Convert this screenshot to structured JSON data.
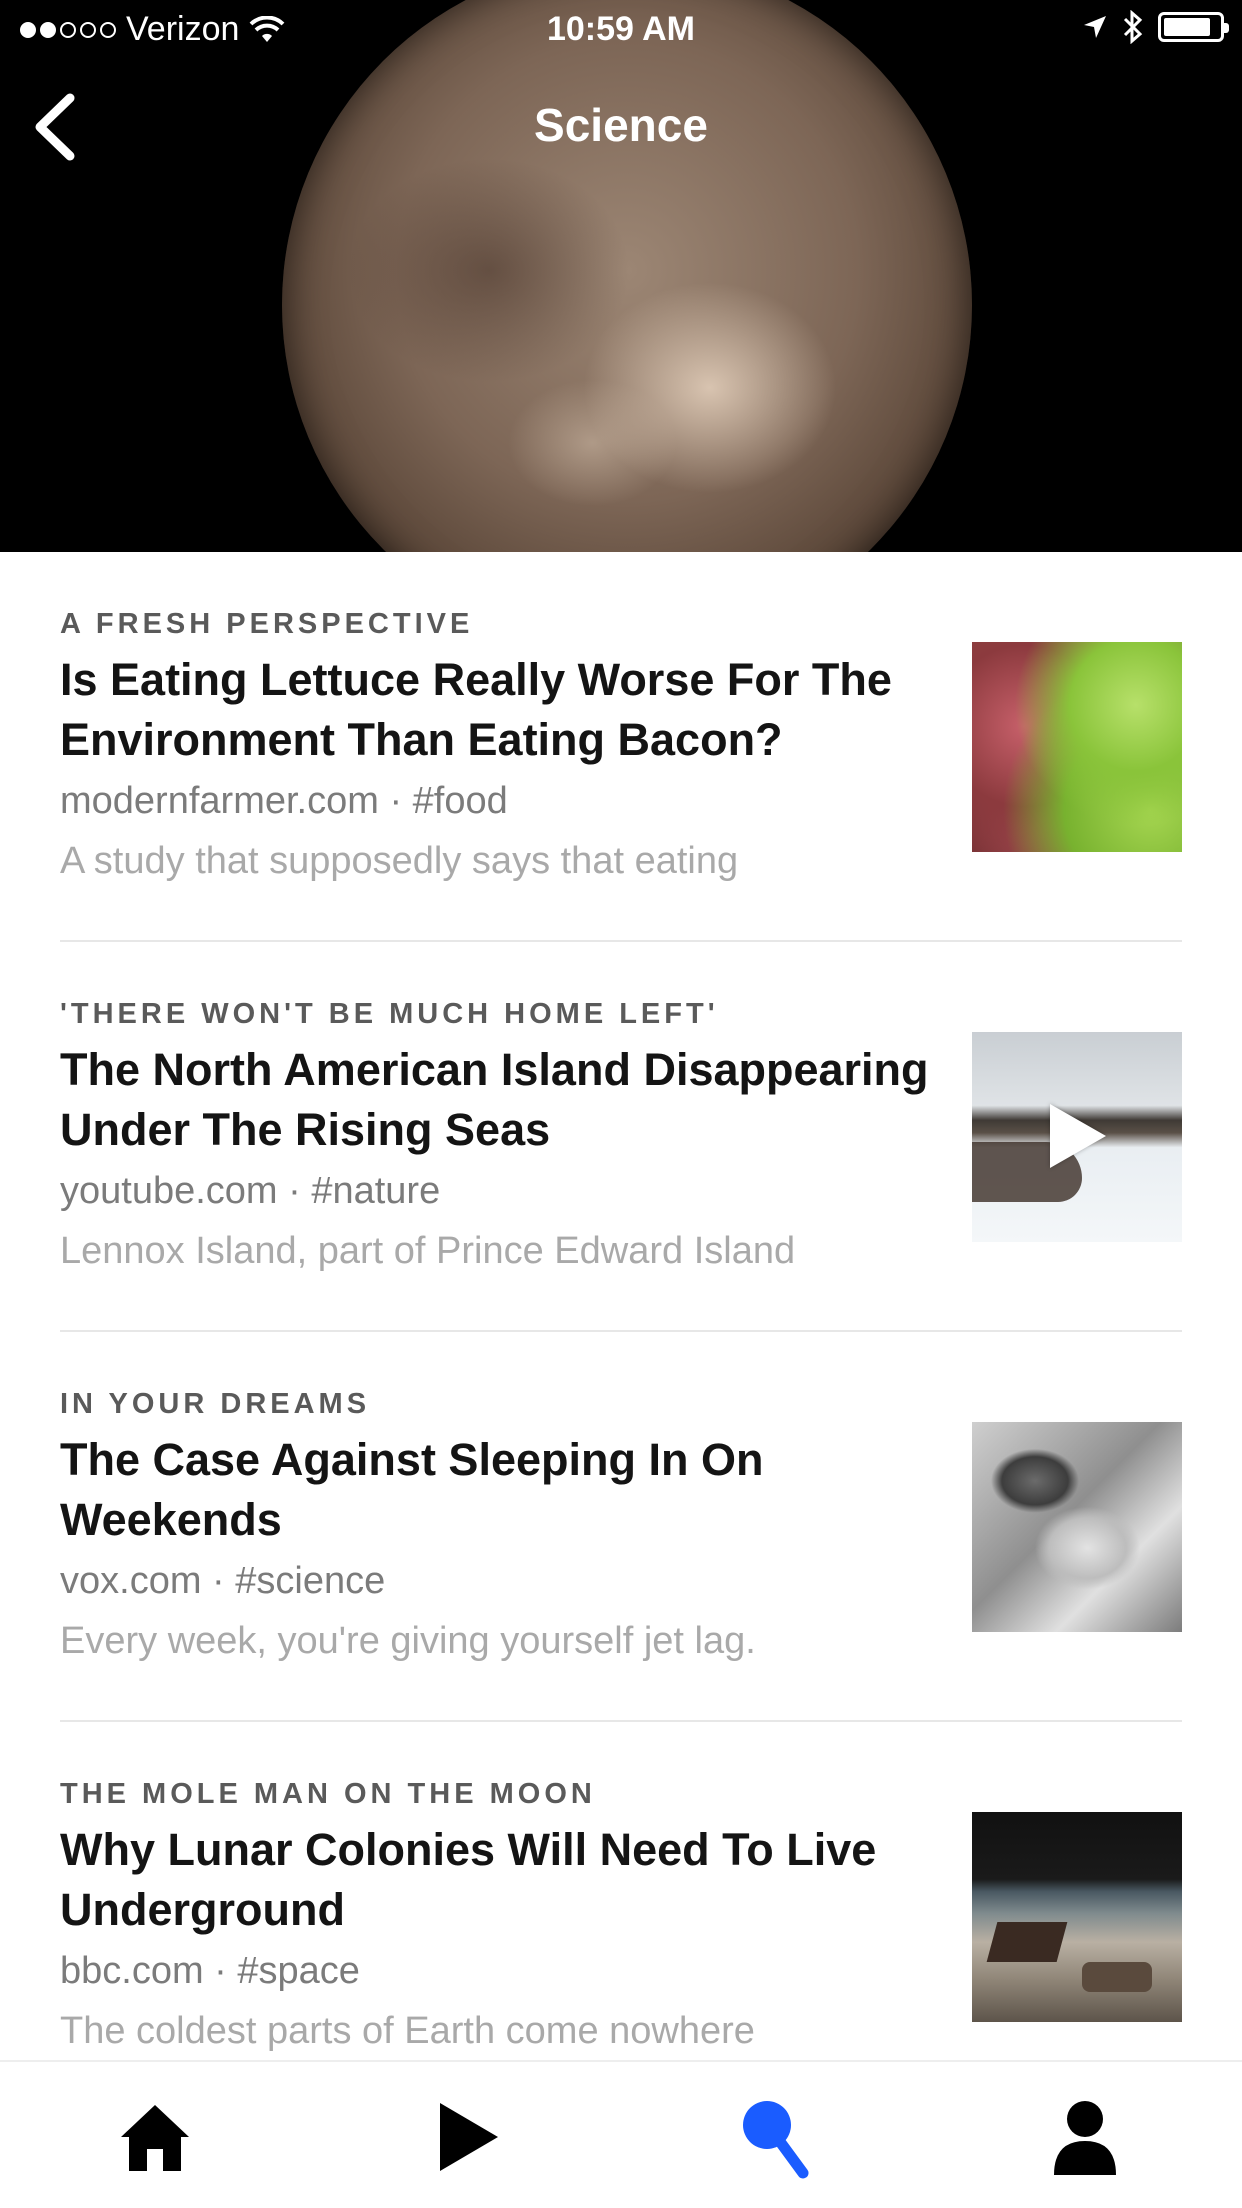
{
  "status_bar": {
    "carrier": "Verizon",
    "time": "10:59 AM",
    "signal_dots_full": 2,
    "signal_dots_total": 5
  },
  "nav": {
    "title": "Science",
    "back_icon": "chevron-left-icon"
  },
  "articles": [
    {
      "kicker": "A FRESH PERSPECTIVE",
      "title": "Is Eating Lettuce Really Worse For The Environment Than Eating Bacon?",
      "meta": "modernfarmer.com · #food",
      "description": "A study that supposedly says that eating",
      "thumbnail": "lettuce-image"
    },
    {
      "kicker": "'THERE WON'T BE MUCH HOME LEFT'",
      "title": "The North American Island Disappearing Under The Rising Seas",
      "meta": "youtube.com · #nature",
      "description": "Lennox Island, part of Prince Edward Island",
      "thumbnail": "snowy-island-video-thumbnail"
    },
    {
      "kicker": "IN YOUR DREAMS",
      "title": "The Case Against Sleeping In On Weekends",
      "meta": "vox.com · #science",
      "description": "Every week, you're giving yourself jet lag.",
      "thumbnail": "sleeping-woman-image"
    },
    {
      "kicker": "THE MOLE MAN ON THE MOON",
      "title": "Why Lunar Colonies Will Need To Live Underground",
      "meta": "bbc.com · #space",
      "description": "The coldest parts of Earth come nowhere",
      "thumbnail": "lunar-colony-image"
    }
  ],
  "tabbar": {
    "tabs": [
      {
        "name": "home",
        "icon": "home-icon",
        "active": false
      },
      {
        "name": "video",
        "icon": "play-icon",
        "active": false
      },
      {
        "name": "search",
        "icon": "search-icon",
        "active": true
      },
      {
        "name": "profile",
        "icon": "person-icon",
        "active": false
      }
    ],
    "active_color": "#1a5cff",
    "inactive_color": "#000000"
  }
}
